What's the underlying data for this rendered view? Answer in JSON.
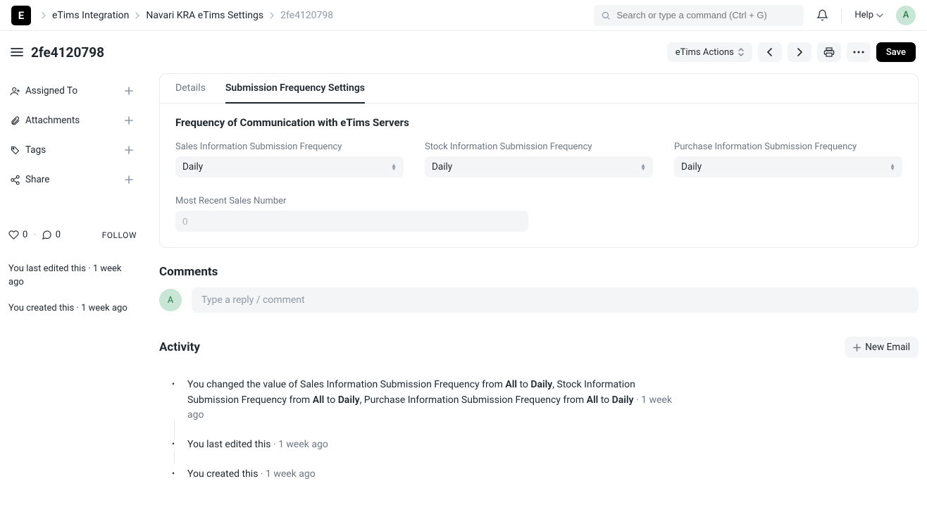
{
  "breadcrumbs": {
    "items": [
      "eTims Integration",
      "Navari KRA eTims Settings",
      "2fe4120798"
    ]
  },
  "search": {
    "placeholder": "Search or type a command (Ctrl + G)"
  },
  "help_label": "Help",
  "user_initial": "A",
  "page": {
    "title": "2fe4120798",
    "actions_menu": "eTims Actions",
    "save_label": "Save"
  },
  "sidebar": {
    "items": [
      {
        "label": "Assigned To",
        "icon": "user-plus"
      },
      {
        "label": "Attachments",
        "icon": "paperclip"
      },
      {
        "label": "Tags",
        "icon": "tag"
      },
      {
        "label": "Share",
        "icon": "share"
      }
    ],
    "likes": "0",
    "comments": "0",
    "follow_label": "FOLLOW",
    "meta": [
      "You last edited this · 1 week ago",
      "You created this · 1 week ago"
    ]
  },
  "tabs": {
    "items": [
      "Details",
      "Submission Frequency Settings"
    ],
    "active_index": 1
  },
  "form": {
    "section_title": "Frequency of Communication with eTims Servers",
    "fields": {
      "sales_label": "Sales Information Submission Frequency",
      "sales_value": "Daily",
      "stock_label": "Stock Information Submission Frequency",
      "stock_value": "Daily",
      "purchase_label": "Purchase Information Submission Frequency",
      "purchase_value": "Daily",
      "recent_sales_label": "Most Recent Sales Number",
      "recent_sales_placeholder": "0"
    }
  },
  "comments": {
    "heading": "Comments",
    "placeholder": "Type a reply / comment"
  },
  "activity": {
    "heading": "Activity",
    "new_email_label": "New Email",
    "items": [
      {
        "html": "You changed the value of Sales Information Submission Frequency from <strong>All</strong> to <strong>Daily</strong>, Stock Information Submission Frequency from <strong>All</strong> to <strong>Daily</strong>, Purchase Information Submission Frequency from <strong>All</strong> to <strong>Daily</strong> <span class='ago'>· 1 week ago</span>"
      },
      {
        "html": "You last edited this <span class='ago'>· 1 week ago</span>"
      },
      {
        "html": "You created this <span class='ago'>· 1 week ago</span>"
      }
    ]
  }
}
